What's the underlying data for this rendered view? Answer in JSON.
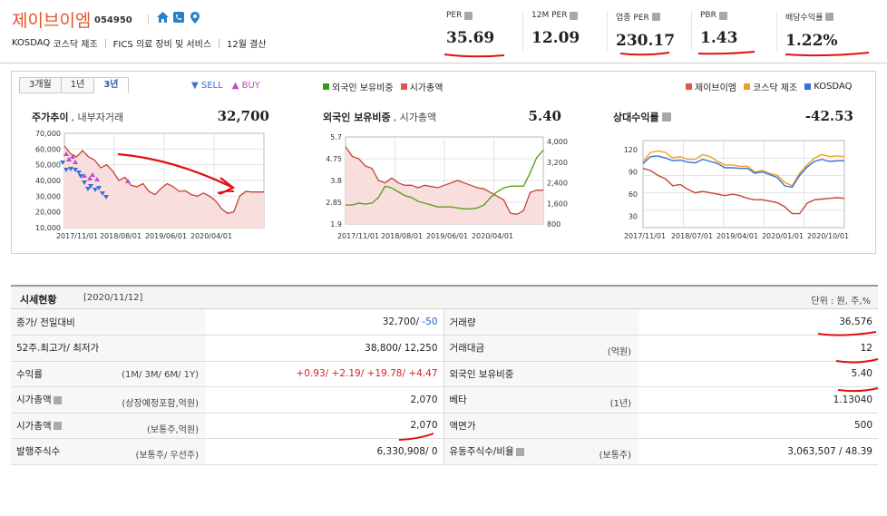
{
  "company": {
    "name": "제이브이엠",
    "code": "054950",
    "market": "KOSDAQ",
    "sector": "코스닥 제조",
    "industry": "FICS 의료 장비 및 서비스",
    "fiscal": "12월 결산"
  },
  "metrics": [
    {
      "label": "PER",
      "value": "35.69"
    },
    {
      "label": "12M PER",
      "value": "12.09"
    },
    {
      "label": "업종 PER",
      "value": "230.17"
    },
    {
      "label": "PBR",
      "value": "1.43"
    },
    {
      "label": "배당수익률",
      "value": "1.22%"
    }
  ],
  "period_tabs": [
    "3개월",
    "1년",
    "3년"
  ],
  "active_tab": "3년",
  "sellbuy": {
    "sell": "SELL",
    "buy": "BUY"
  },
  "legend_mid": [
    {
      "label": "외국인 보유비중",
      "color": "#3a9a1a"
    },
    {
      "label": "시가총액",
      "color": "#e05545"
    }
  ],
  "legend_right": [
    {
      "label": "제이브이엠",
      "color": "#e05545"
    },
    {
      "label": "코스닥 제조",
      "color": "#f0a020"
    },
    {
      "label": "KOSDAQ",
      "color": "#3a6fd8"
    }
  ],
  "charts": {
    "price": {
      "title": "주가추이",
      "subtitle": ", 내부자거래",
      "value": "32,700"
    },
    "foreign": {
      "title": "외국인 보유비중",
      "subtitle": ", 시가총액",
      "value": "5.40"
    },
    "relative": {
      "title": "상대수익률",
      "value": "-42.53"
    }
  },
  "chart_data": [
    {
      "type": "area",
      "yticks": [
        "70,000",
        "60,000",
        "50,000",
        "40,000",
        "30,000",
        "20,000",
        "10,000"
      ],
      "xticks": [
        "2017/11/01",
        "2018/08/01",
        "2019/06/01",
        "2020/04/01"
      ],
      "ylim": [
        10000,
        70000
      ],
      "series": [
        {
          "values": [
            62000,
            57000,
            55000,
            59000,
            55000,
            53000,
            48000,
            50000,
            46000,
            40000,
            42000,
            37000,
            36000,
            38000,
            33000,
            31000,
            35000,
            38000,
            36000,
            33000,
            33500,
            31000,
            30000,
            32000,
            30000,
            27000,
            22000,
            19000,
            20000,
            30000,
            33000,
            32700,
            32700,
            32700
          ]
        }
      ]
    },
    {
      "type": "line",
      "yticks_left": [
        "5.7",
        "4.75",
        "3.8",
        "2.85",
        "1.9"
      ],
      "yticks_right": [
        "4,000",
        "3,200",
        "2,400",
        "1,600",
        "800"
      ],
      "xticks": [
        "2017/11/01",
        "2018/08/01",
        "2019/06/01",
        "2020/04/01"
      ],
      "series": [
        {
          "values": [
            2.5,
            2.5,
            2.6,
            2.55,
            2.6,
            2.9,
            3.5,
            3.4,
            3.2,
            3.0,
            2.9,
            2.7,
            2.6,
            2.5,
            2.4,
            2.4,
            2.4,
            2.35,
            2.3,
            2.3,
            2.35,
            2.5,
            2.9,
            3.2,
            3.4,
            3.5,
            3.5,
            3.5,
            4.2,
            5.0,
            5.4
          ]
        },
        {
          "values": [
            3900,
            3500,
            3400,
            3100,
            3000,
            2500,
            2400,
            2600,
            2400,
            2300,
            2300,
            2200,
            2300,
            2250,
            2200,
            2300,
            2400,
            2500,
            2400,
            2300,
            2200,
            2150,
            2000,
            1850,
            1700,
            1150,
            1100,
            1250,
            2000,
            2100,
            2100
          ]
        }
      ]
    },
    {
      "type": "line",
      "yticks": [
        "120",
        "90",
        "60",
        "30"
      ],
      "xticks": [
        "2017/11/01",
        "2018/07/01",
        "2019/04/01",
        "2020/01/01",
        "2020/10/01"
      ],
      "series": [
        {
          "values": [
            95,
            92,
            85,
            80,
            70,
            72,
            65,
            60,
            62,
            60,
            58,
            56,
            58,
            56,
            52,
            50,
            50,
            48,
            46,
            40,
            30,
            30,
            45,
            50,
            51,
            52,
            53,
            52
          ]
        },
        {
          "values": [
            105,
            118,
            120,
            118,
            110,
            112,
            108,
            108,
            115,
            112,
            105,
            100,
            100,
            98,
            98,
            90,
            92,
            88,
            85,
            75,
            70,
            88,
            100,
            110,
            115,
            112,
            113,
            112
          ]
        },
        {
          "values": [
            102,
            112,
            113,
            110,
            106,
            107,
            104,
            103,
            108,
            105,
            102,
            96,
            96,
            95,
            95,
            88,
            90,
            86,
            82,
            70,
            68,
            85,
            97,
            105,
            108,
            105,
            106,
            106
          ]
        }
      ]
    }
  ],
  "table": {
    "title": "시세현황",
    "date": "[2020/11/12]",
    "unit": "단위 : 원, 주,%",
    "rows": [
      {
        "l1": "종가/ 전일대비",
        "s1": "",
        "v1a": "32,700/",
        "v1b": "-50",
        "l2": "거래량",
        "s2": "",
        "v2": "36,576"
      },
      {
        "l1": "52주.최고가/ 최저가",
        "s1": "",
        "v1a": "38,800/ 12,250",
        "v1b": "",
        "l2": "거래대금",
        "s2": "(억원)",
        "v2": "12"
      },
      {
        "l1": "수익률",
        "s1": "(1M/ 3M/ 6M/ 1Y)",
        "v1a": "+0.93/ +2.19/ +19.78/ +4.47",
        "v1b": "",
        "l2": "외국인 보유비중",
        "s2": "",
        "v2": "5.40"
      },
      {
        "l1": "시가총액",
        "s1": "(상장예정포함,억원)",
        "v1a": "2,070",
        "v1b": "",
        "l2": "베타",
        "s2": "(1년)",
        "v2": "1.13040"
      },
      {
        "l1": "시가총액",
        "s1": "(보통주,억원)",
        "v1a": "2,070",
        "v1b": "",
        "l2": "액면가",
        "s2": "",
        "v2": "500"
      },
      {
        "l1": "발행주식수",
        "s1": "(보통주/ 우선주)",
        "v1a": "6,330,908/ 0",
        "v1b": "",
        "l2": "유동주식수/비율",
        "s2": "(보통주)",
        "v2": "3,063,507 / 48.39"
      }
    ]
  }
}
